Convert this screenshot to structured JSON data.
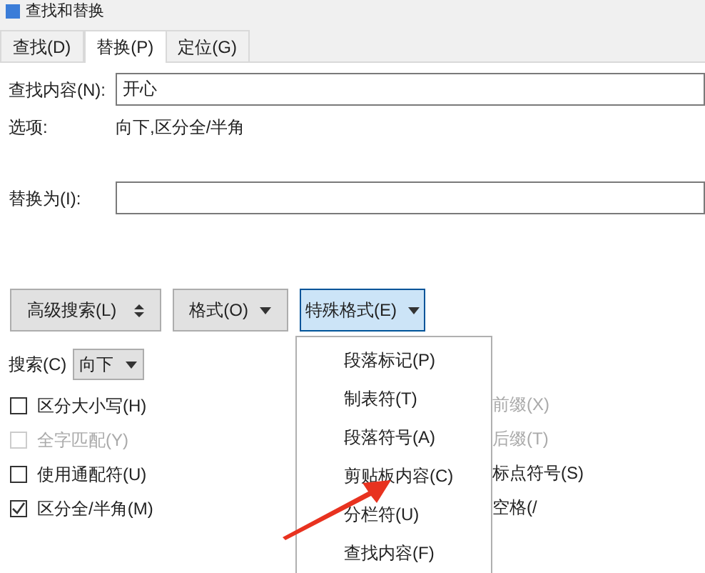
{
  "window": {
    "title": "查找和替换"
  },
  "tabs": [
    {
      "label": "查找(D)",
      "selected": false
    },
    {
      "label": "替换(P)",
      "selected": true
    },
    {
      "label": "定位(G)",
      "selected": false
    }
  ],
  "find": {
    "label": "查找内容(N):",
    "value": "开心"
  },
  "options": {
    "label": "选项:",
    "value": "向下,区分全/半角"
  },
  "replace": {
    "label": "替换为(I):"
  },
  "buttons": [
    {
      "label": "高级搜索(L)",
      "kind": "toggle",
      "active": false
    },
    {
      "label": "格式(O)",
      "kind": "menu",
      "active": false
    },
    {
      "label": "特殊格式(E)",
      "kind": "menu",
      "active": true
    }
  ],
  "search": {
    "label": "搜索(C)",
    "value": "向下"
  },
  "checkboxes": [
    {
      "label": "区分大小写(H)",
      "checked": false,
      "disabled": false
    },
    {
      "label": "全字匹配(Y)",
      "checked": false,
      "disabled": true
    },
    {
      "label": "使用通配符(U)",
      "checked": false,
      "disabled": false
    },
    {
      "label": "区分全/半角(M)",
      "checked": true,
      "disabled": false
    }
  ],
  "right_options": [
    {
      "label": "前缀(X)",
      "disabled": true
    },
    {
      "label": "后缀(T)",
      "disabled": true
    },
    {
      "label": "标点符号(S)",
      "disabled": false
    },
    {
      "label": "空格(/",
      "disabled": false
    }
  ],
  "menu": {
    "items": [
      "段落标记(P)",
      "制表符(T)",
      "段落符号(A)",
      "剪贴板内容(C)",
      "分栏符(U)",
      "查找内容(F)"
    ]
  }
}
